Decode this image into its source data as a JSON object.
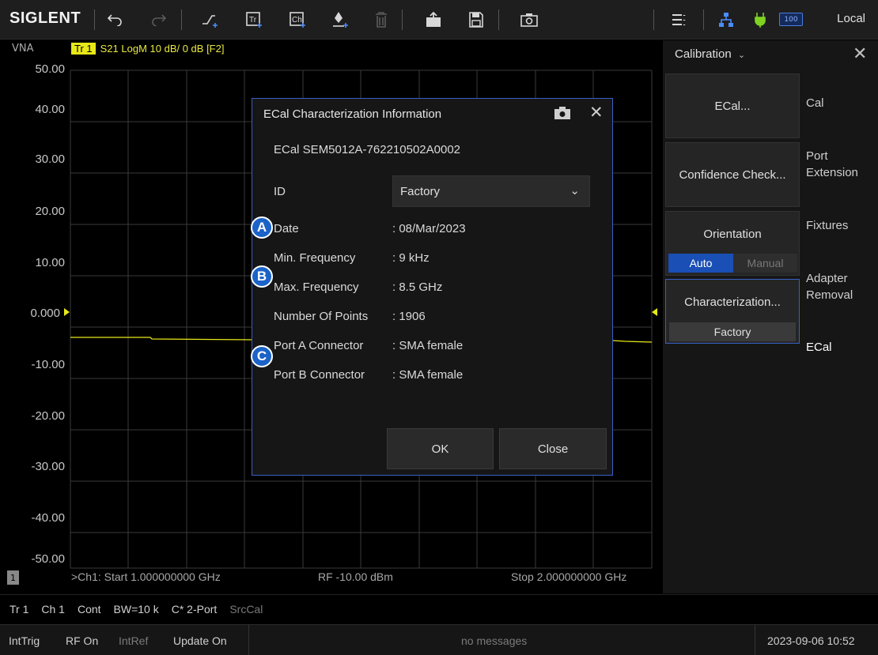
{
  "toolbar": {
    "logo": "SIGLENT",
    "status": "Local",
    "battery": "100",
    "icons": [
      "undo-icon",
      "redo-icon",
      "trace-add-icon",
      "trace-icon",
      "channel-icon",
      "marker-icon",
      "delete-icon",
      "open-icon",
      "save-icon",
      "camera-icon",
      "menu-icon",
      "network-icon",
      "power-icon",
      "battery-icon"
    ]
  },
  "plot": {
    "vna": "VNA",
    "trace_id": "Tr 1",
    "trace_desc": "S21 LogM 10 dB/ 0 dB [F2]",
    "y_labels": [
      "50.00",
      "40.00",
      "30.00",
      "20.00",
      "10.00",
      "0.000",
      "-10.00",
      "-20.00",
      "-30.00",
      "-40.00",
      "-50.00"
    ],
    "channel_num": "1",
    "start": ">Ch1: Start 1.000000000 GHz",
    "power": "RF -10.00 dBm",
    "stop": "Stop 2.000000000 GHz",
    "trace_color": "#e8e818"
  },
  "status1": {
    "tr": "Tr 1",
    "ch": "Ch 1",
    "cont": "Cont",
    "bw": "BW=10 k",
    "port": "C* 2-Port",
    "srccal": "SrcCal"
  },
  "status2": {
    "trig": "IntTrig",
    "rf": "RF On",
    "ref": "IntRef",
    "update": "Update On",
    "messages": "no messages",
    "datetime": "2023-09-06 10:52"
  },
  "panel": {
    "title": "Calibration",
    "ecal_btn": "ECal...",
    "confidence_btn": "Confidence Check...",
    "orientation": "Orientation",
    "auto": "Auto",
    "manual": "Manual",
    "characterization": "Characterization...",
    "char_value": "Factory",
    "tabs": {
      "cal": "Cal",
      "port_ext_1": "Port",
      "port_ext_2": "Extension",
      "fixtures": "Fixtures",
      "adapter_1": "Adapter",
      "adapter_2": "Removal",
      "ecal": "ECal"
    }
  },
  "dialog": {
    "title": "ECal Characterization Information",
    "ecal_id": "ECal  SEM5012A-762210502A0002",
    "id_label": "ID",
    "id_value": "Factory",
    "rows": [
      {
        "label": "Date",
        "value": ": 08/Mar/2023"
      },
      {
        "label": "Min. Frequency",
        "value": ": 9 kHz"
      },
      {
        "label": "Max. Frequency",
        "value": ": 8.5 GHz"
      },
      {
        "label": "Number Of Points",
        "value": ": 1906"
      },
      {
        "label": "Port A Connector",
        "value": ": SMA female"
      },
      {
        "label": "Port B Connector",
        "value": ": SMA female"
      }
    ],
    "ok": "OK",
    "close": "Close"
  },
  "callouts": [
    "A",
    "B",
    "C"
  ]
}
